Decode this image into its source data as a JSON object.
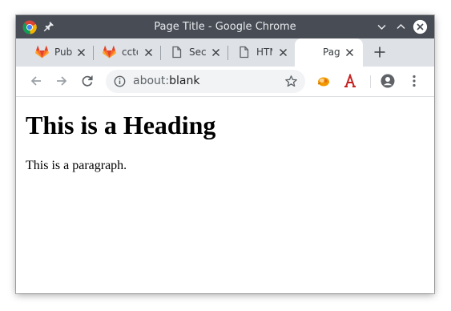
{
  "window": {
    "title": "Page Title - Google Chrome"
  },
  "tabs": [
    {
      "label": "Pub",
      "icon": "gitlab-icon"
    },
    {
      "label": "ccto",
      "icon": "gitlab-icon"
    },
    {
      "label": "Sec",
      "icon": "document-icon"
    },
    {
      "label": "HTM",
      "icon": "document-icon"
    },
    {
      "label": "Pag",
      "icon": "none",
      "active": true
    }
  ],
  "omnibox": {
    "scheme": "about:",
    "path": "blank"
  },
  "page": {
    "heading": "This is a Heading",
    "paragraph": "This is a paragraph."
  },
  "colors": {
    "titlebar": "#474c55",
    "tabstrip": "#dee1e6",
    "omnibox": "#f1f3f4",
    "gitlab_orange": "#e24329"
  }
}
